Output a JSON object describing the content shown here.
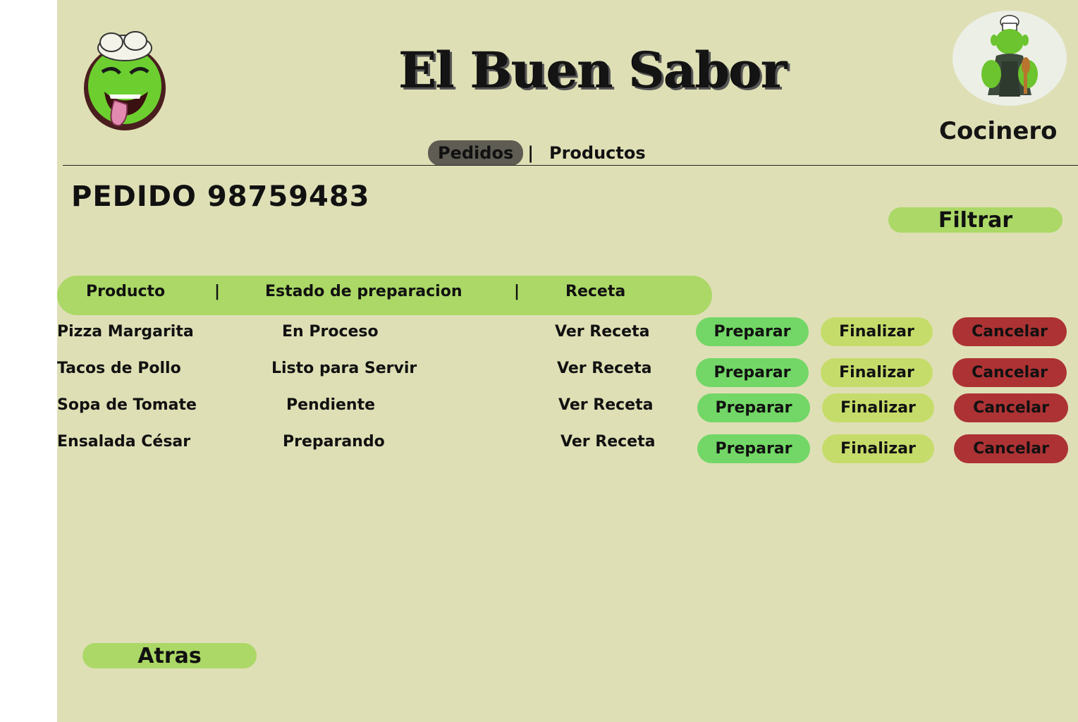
{
  "header": {
    "brand_title": "El Buen Sabor",
    "role": "Cocinero",
    "logo_icon": "ogre-chef-logo-icon",
    "avatar_icon": "chef-avatar-icon"
  },
  "nav": {
    "tabs": [
      {
        "label": "Pedidos",
        "active": true
      },
      {
        "label": "Productos",
        "active": false
      }
    ],
    "separator": "|"
  },
  "order": {
    "title": "PEDIDO 98759483"
  },
  "filter_label": "Filtrar",
  "back_label": "Atras",
  "table": {
    "columns": [
      "Producto",
      "Estado de preparacion",
      "Receta"
    ],
    "separator": "|",
    "rows": [
      {
        "product": "Pizza Margarita",
        "status": "En Proceso",
        "recipe": "Ver Receta",
        "prepare": "Preparar",
        "finish": "Finalizar",
        "cancel": "Cancelar"
      },
      {
        "product": "Tacos de Pollo",
        "status": "Listo para Servir",
        "recipe": "Ver Receta",
        "prepare": "Preparar",
        "finish": "Finalizar",
        "cancel": "Cancelar"
      },
      {
        "product": "Sopa de Tomate",
        "status": "Pendiente",
        "recipe": "Ver Receta",
        "prepare": "Preparar",
        "finish": "Finalizar",
        "cancel": "Cancelar"
      },
      {
        "product": "Ensalada César",
        "status": "Preparando",
        "recipe": "Ver Receta",
        "prepare": "Preparar",
        "finish": "Finalizar",
        "cancel": "Cancelar"
      }
    ]
  },
  "colors": {
    "background": "#dfdfb6",
    "accent_green": "#abd866",
    "prepare_green": "#72d766",
    "finish_lime": "#c6dc6a",
    "cancel_red": "#ad3234",
    "active_tab": "#5e5c53"
  }
}
